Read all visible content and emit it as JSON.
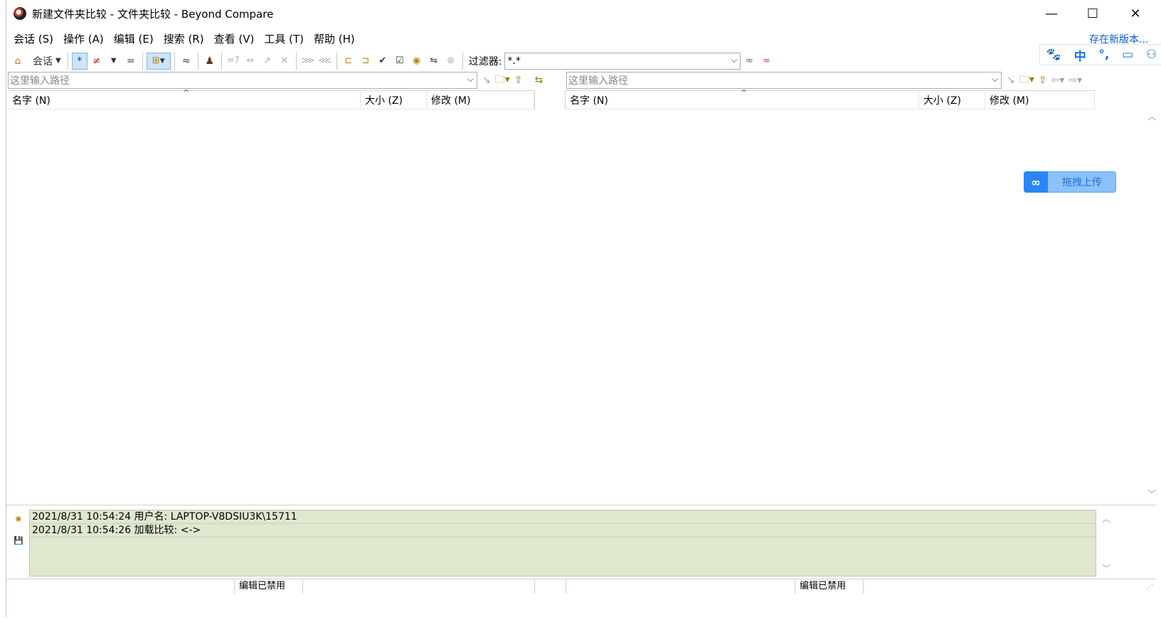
{
  "window": {
    "title": "新建文件夹比较 - 文件夹比较 - Beyond Compare",
    "minimize": "—",
    "maximize": "☐",
    "close": "✕"
  },
  "menu": {
    "items": [
      "会话 (S)",
      "操作 (A)",
      "编辑 (E)",
      "搜索 (R)",
      "查看 (V)",
      "工具 (T)",
      "帮助 (H)"
    ],
    "new_version": "存在新版本..."
  },
  "toolbar": {
    "session_label": "会话",
    "filter_label": "过滤器:",
    "filter_value": "*.*"
  },
  "ime": {
    "paw": "🐾",
    "lang": "中",
    "punct": "°,",
    "screen": "▭",
    "user": "⚇"
  },
  "left_pane": {
    "path_placeholder": "这里输入路径",
    "columns": [
      "名字 (N)",
      "大小 (Z)",
      "修改 (M)"
    ]
  },
  "right_pane": {
    "path_placeholder": "这里输入路径",
    "columns": [
      "名字 (N)",
      "大小 (Z)",
      "修改 (M)"
    ]
  },
  "upload_widget": {
    "label": "拖拽上传"
  },
  "log": {
    "lines": [
      "2021/8/31 10:54:24  用户名:  LAPTOP-V8DSIU3K\\15711",
      "2021/8/31 10:54:26  加载比较:  <->"
    ]
  },
  "status": {
    "left": "编辑已禁用",
    "right": "编辑已禁用"
  }
}
